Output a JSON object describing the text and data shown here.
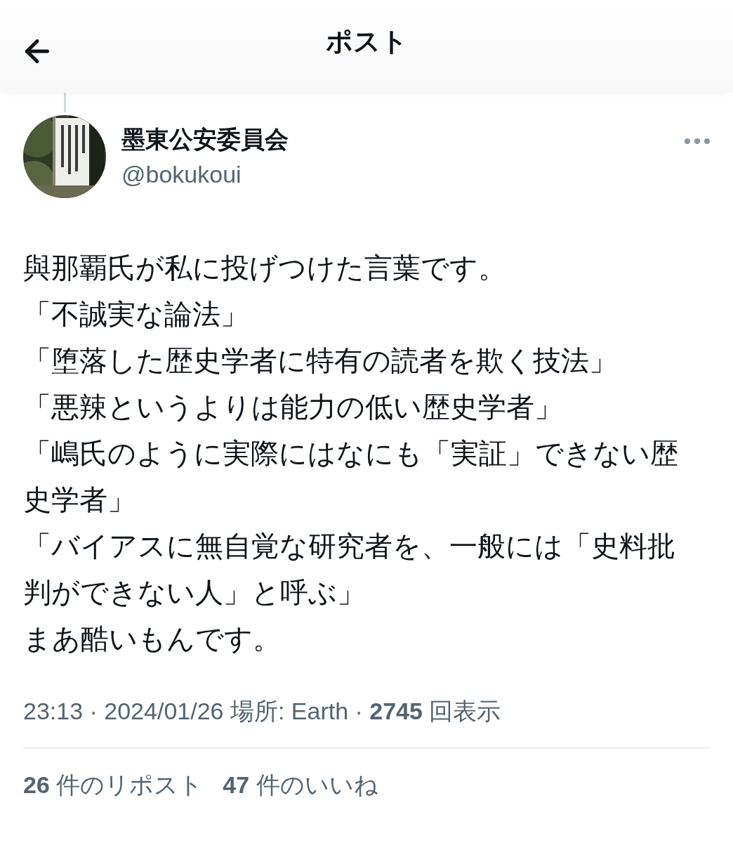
{
  "header": {
    "title": "ポスト"
  },
  "author": {
    "name": "墨東公安委員会",
    "handle": "@bokukoui"
  },
  "body_lines": [
    "與那覇氏が私に投げつけた言葉です。",
    "「不誠実な論法」",
    "「堕落した歴史学者に特有の読者を欺く技法」",
    "「悪辣というよりは能力の低い歴史学者」",
    "「嶋氏のように実際にはなにも「実証」できない歴",
    "史学者」",
    "「バイアスに無自覚な研究者を、一般には「史料批",
    "判ができない人」と呼ぶ」",
    "まあ酷いもんです。"
  ],
  "meta": "23:13 · 2024/01/26 場所: Earth · **2745** 回表示",
  "stats": [
    "**26** 件のリポスト",
    "**47** 件のいいね"
  ]
}
